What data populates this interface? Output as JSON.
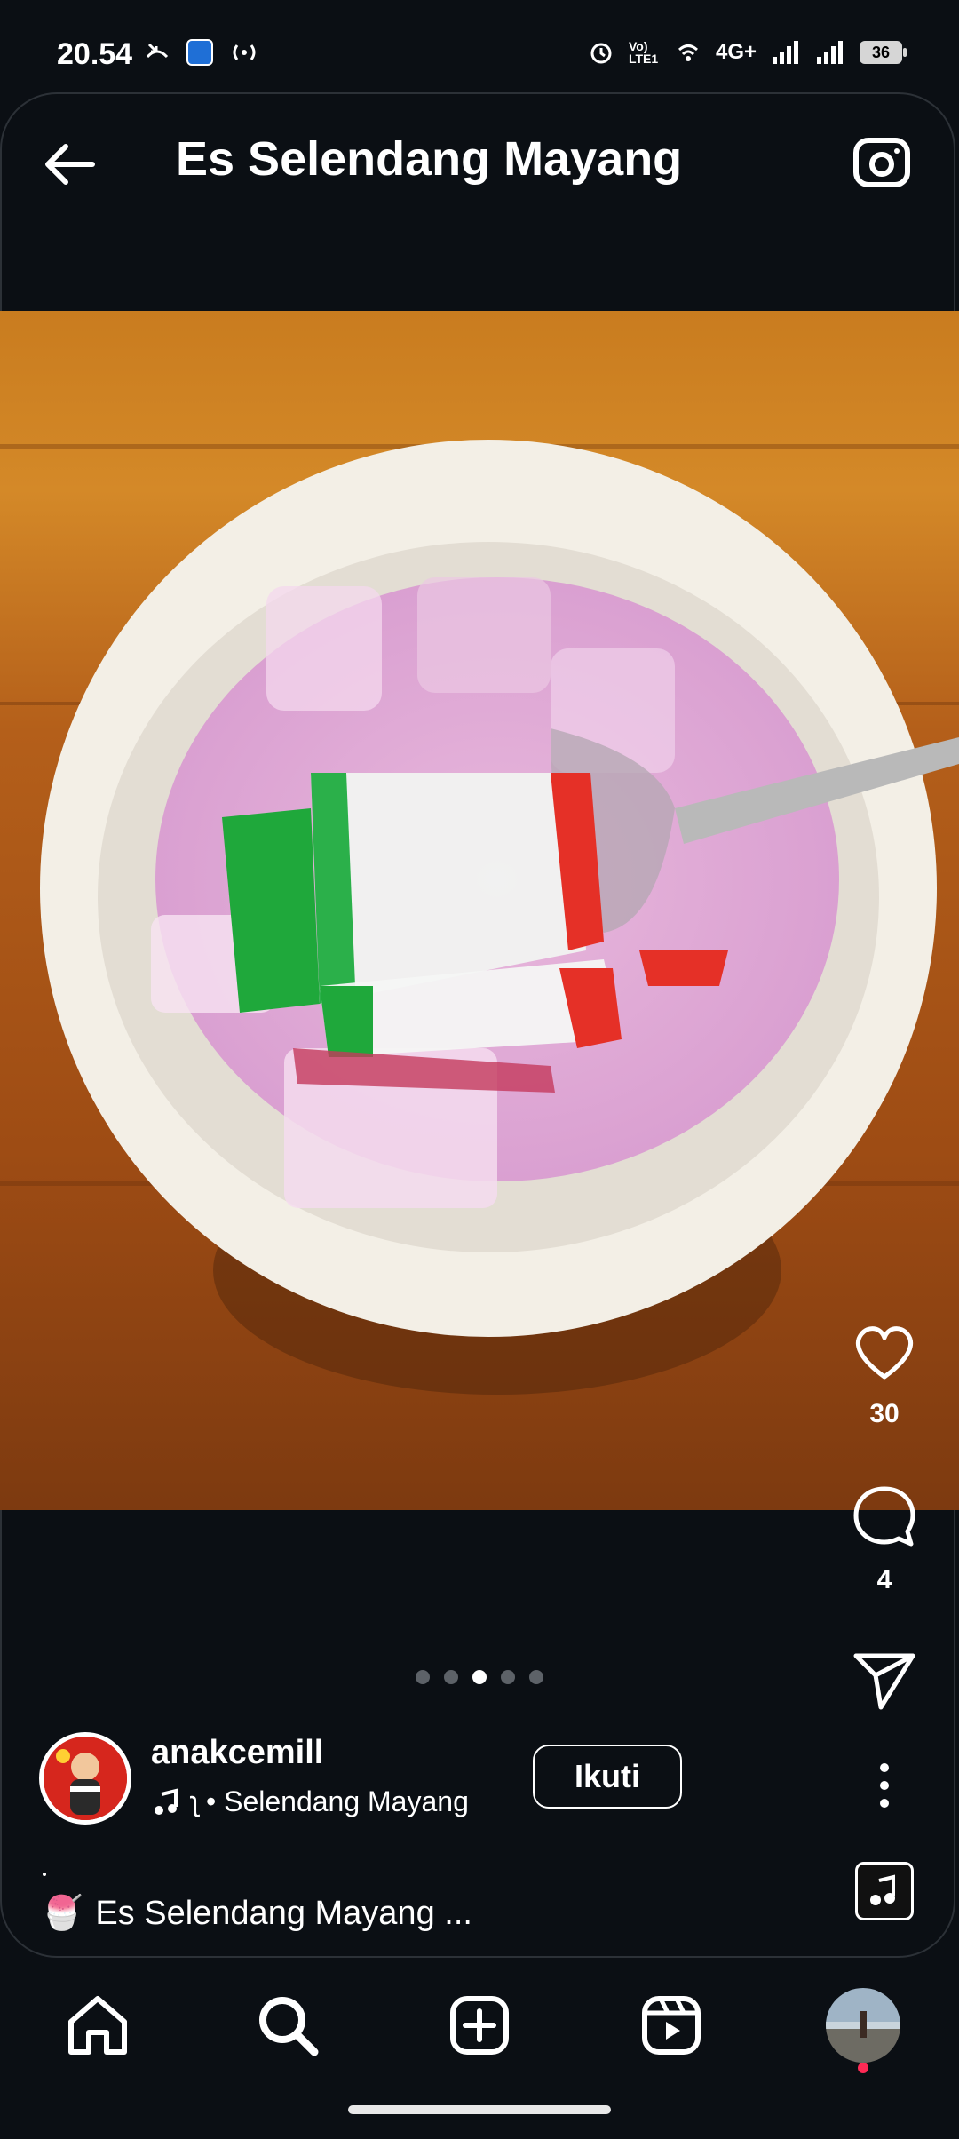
{
  "status": {
    "time": "20.54",
    "network": "4G+",
    "volte": "Vo) LTE1",
    "battery": "36"
  },
  "header": {
    "title": "Es Selendang Mayang"
  },
  "post": {
    "likes": "30",
    "comments": "4",
    "carousel": {
      "count": 5,
      "active_index": 3
    },
    "username": "anakcemill",
    "audio_text": "ʅ • Selendang Mayang",
    "follow_label": "Ikuti",
    "caption_dot": ".",
    "caption_emoji": "🍧",
    "caption": "Es Selendang Mayang ..."
  },
  "icons": {
    "back": "arrow-left",
    "camera": "camera",
    "like": "heart",
    "comment": "comment-bubble",
    "share": "paper-plane",
    "more": "vertical-dots",
    "music": "music-note",
    "nav": [
      "home",
      "search",
      "create",
      "reels",
      "profile"
    ]
  },
  "colors": {
    "background": "#0b0f14",
    "active_dot": "#ffffff",
    "inactive_dot": "#5d6268",
    "notification_dot": "#ff2a55"
  }
}
